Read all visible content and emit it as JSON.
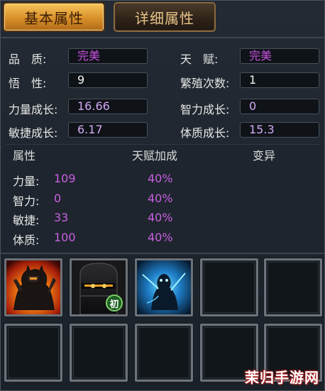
{
  "tabs": {
    "basic": "基本属性",
    "detail": "详细属性"
  },
  "attributes": {
    "quality_label": "品　质:",
    "quality_value": "完美",
    "talent_label": "天　赋:",
    "talent_value": "完美",
    "comprehension_label": "悟　性:",
    "comprehension_value": "9",
    "breed_label": "繁殖次数:",
    "breed_value": "1",
    "str_growth_label": "力量成长:",
    "str_growth_value": "16.66",
    "int_growth_label": "智力成长:",
    "int_growth_value": "0",
    "agi_growth_label": "敏捷成长:",
    "agi_growth_value": "6.17",
    "con_growth_label": "体质成长:",
    "con_growth_value": "15.3"
  },
  "stats": {
    "headers": [
      "属性",
      "天赋加成",
      "变异"
    ],
    "rows": [
      {
        "label": "力量:",
        "value": "109",
        "bonus": "40%"
      },
      {
        "label": "智力:",
        "value": "0",
        "bonus": "40%"
      },
      {
        "label": "敏捷:",
        "value": "33",
        "bonus": "40%"
      },
      {
        "label": "体质:",
        "value": "100",
        "bonus": "40%"
      }
    ]
  },
  "skills": {
    "slot2_badge": "初",
    "icons": [
      "fire-warrior-skill-icon",
      "dark-knight-helm-skill-icon",
      "blue-spirit-skill-icon"
    ]
  },
  "watermark": "茉归手游网",
  "colors": {
    "value_purple": "#c850e0",
    "tab_active_gold": "#d8902a",
    "tab_inactive_brown": "#2d2218"
  }
}
